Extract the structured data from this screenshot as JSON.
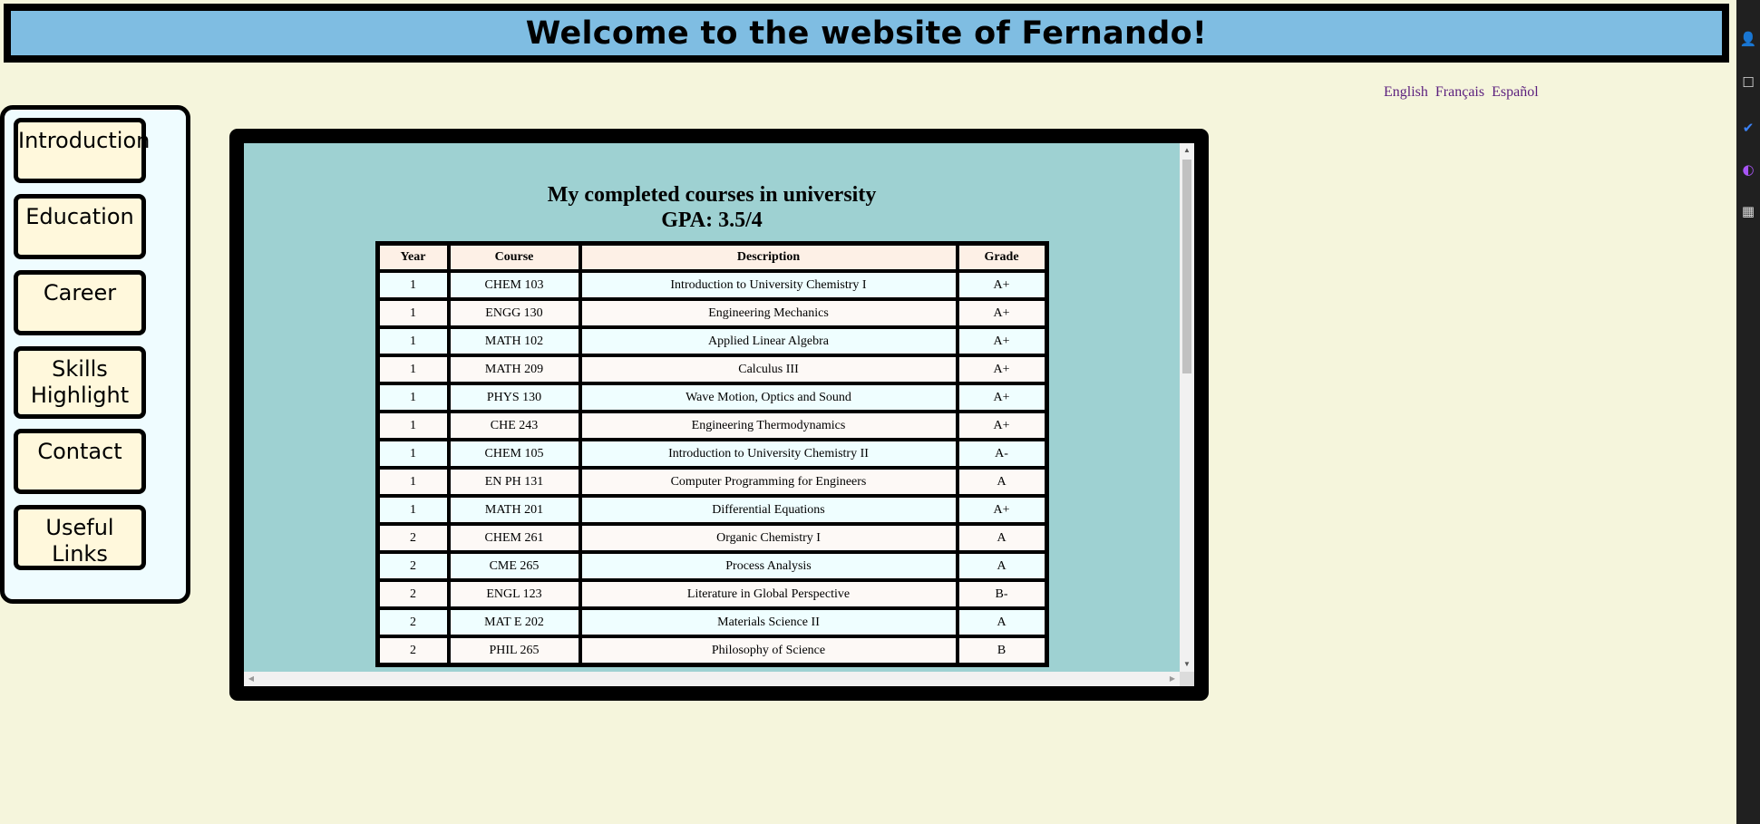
{
  "header": {
    "title": "Welcome to the website of Fernando!"
  },
  "languages": [
    "English",
    "Français",
    "Español"
  ],
  "sidebar": {
    "items": [
      {
        "label": "Introduction"
      },
      {
        "label": "Education"
      },
      {
        "label": "Career"
      },
      {
        "label": "Skills Highlight"
      },
      {
        "label": "Contact"
      },
      {
        "label": "Useful Links"
      }
    ]
  },
  "courses": {
    "title": "My completed courses in university",
    "gpa": "GPA: 3.5/4",
    "headers": [
      "Year",
      "Course",
      "Description",
      "Grade"
    ],
    "rows": [
      [
        "1",
        "CHEM 103",
        "Introduction to University Chemistry I",
        "A+"
      ],
      [
        "1",
        "ENGG 130",
        "Engineering Mechanics",
        "A+"
      ],
      [
        "1",
        "MATH 102",
        "Applied Linear Algebra",
        "A+"
      ],
      [
        "1",
        "MATH 209",
        "Calculus III",
        "A+"
      ],
      [
        "1",
        "PHYS 130",
        "Wave Motion, Optics and Sound",
        "A+"
      ],
      [
        "1",
        "CHE 243",
        "Engineering Thermodynamics",
        "A+"
      ],
      [
        "1",
        "CHEM 105",
        "Introduction to University Chemistry II",
        "A-"
      ],
      [
        "1",
        "EN PH 131",
        "Computer Programming for Engineers",
        "A"
      ],
      [
        "1",
        "MATH 201",
        "Differential Equations",
        "A+"
      ],
      [
        "2",
        "CHEM 261",
        "Organic Chemistry I",
        "A"
      ],
      [
        "2",
        "CME 265",
        "Process Analysis",
        "A"
      ],
      [
        "2",
        "ENGL 123",
        "Literature in Global Perspective",
        "B-"
      ],
      [
        "2",
        "MAT E 202",
        "Materials Science II",
        "A"
      ],
      [
        "2",
        "PHIL 265",
        "Philosophy of Science",
        "B"
      ]
    ]
  },
  "colors": {
    "page_bg": "#f5f5dc",
    "header_bg": "#7fbde2",
    "content_bg": "#9ed1d2",
    "nav_button_bg": "#fff8dc",
    "link": "#5b1f7e"
  }
}
